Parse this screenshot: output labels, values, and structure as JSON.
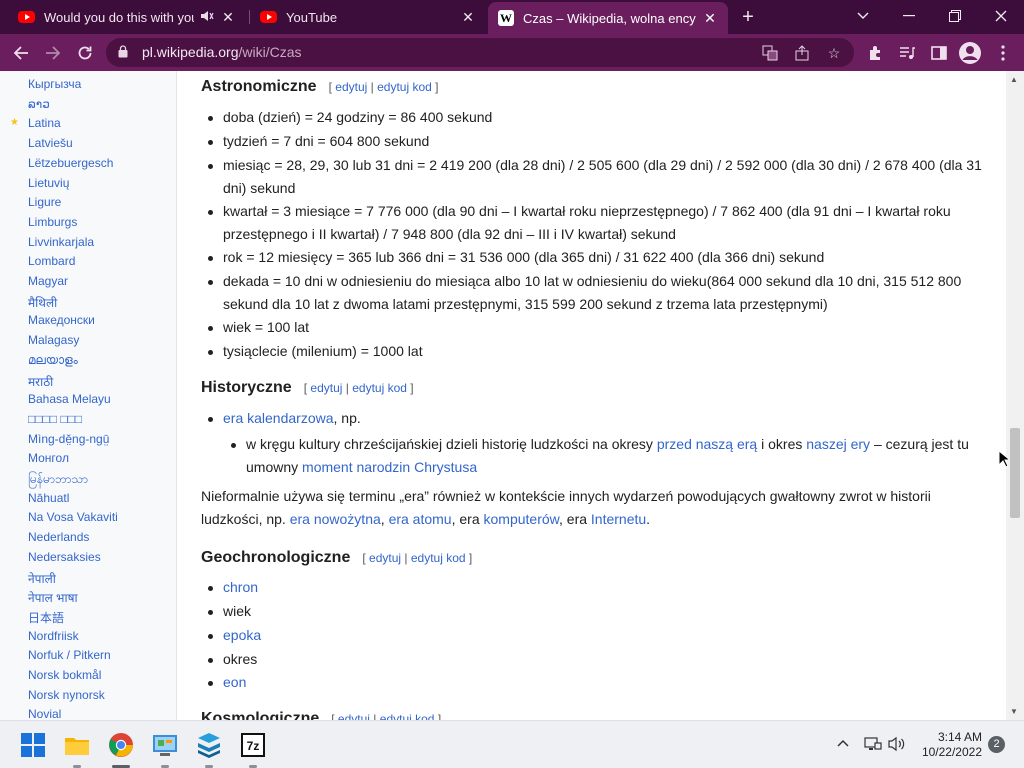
{
  "browser": {
    "tabs": [
      {
        "title": "Would you do this with your",
        "icon": "youtube-icon",
        "audio": true
      },
      {
        "title": "YouTube",
        "icon": "youtube-icon",
        "audio": false
      },
      {
        "title": "Czas – Wikipedia, wolna encyklop",
        "icon": "wikipedia-icon",
        "audio": false,
        "active": true
      }
    ],
    "new_tab_glyph": "+",
    "url_host": "pl.wikipedia.org",
    "url_path": "/wiki/Czas"
  },
  "sidebar": {
    "languages": [
      "Кыргызча",
      "ລາວ",
      "Latina",
      "Latviešu",
      "Lëtzebuergesch",
      "Lietuvių",
      "Ligure",
      "Limburgs",
      "Livvinkarjala",
      "Lombard",
      "Magyar",
      "मैथिली",
      "Македонски",
      "Malagasy",
      "മലയാളം",
      "मराठी",
      "Bahasa Melayu",
      "□□□□ □□□",
      "Mìng-dĕ̤ng-ngṳ̄",
      "Монгол",
      "မြန်မာဘာသာ",
      "Nāhuatl",
      "Na Vosa Vakaviti",
      "Nederlands",
      "Nedersaksies",
      "नेपाली",
      "नेपाल भाषा",
      "日本語",
      "Nordfriisk",
      "Norfuk / Pitkern",
      "Norsk bokmål",
      "Norsk nynorsk",
      "Novial"
    ],
    "featured_marker": "★",
    "featured_index": 2
  },
  "content": {
    "edit_links": {
      "open": "[",
      "edit": "edytuj",
      "sep": "|",
      "edit_code": "edytuj kod",
      "close": "]"
    },
    "sections": {
      "astro": {
        "heading": "Astronomiczne",
        "items": [
          "doba (dzień) = 24 godziny = 86 400 sekund",
          "tydzień = 7 dni = 604 800 sekund",
          "miesiąc = 28, 29, 30 lub 31 dni = 2 419 200 (dla 28 dni) / 2 505 600 (dla 29 dni) / 2 592 000 (dla 30 dni) / 2 678 400 (dla 31 dni) sekund",
          "kwartał = 3 miesiące = 7 776 000 (dla 90 dni – I kwartał roku nieprzestępnego) / 7 862 400 (dla 91 dni – I kwartał roku przestępnego i II kwartał) / 7 948 800 (dla 92 dni – III i IV kwartał) sekund",
          "rok = 12 miesięcy = 365 lub 366 dni = 31 536 000 (dla 365 dni) / 31 622 400 (dla 366 dni) sekund",
          "dekada = 10 dni w odniesieniu do miesiąca albo 10 lat w odniesieniu do wieku(864 000 sekund dla 10 dni, 315 512 800 sekund dla 10 lat z dwoma latami przestępnymi, 315 599 200 sekund z trzema lata przestępnymi)",
          "wiek = 100 lat",
          "tysiąclecie (milenium) = 1000 lat"
        ]
      },
      "hist": {
        "heading": "Historyczne",
        "item1_link": "era kalendarzowa",
        "item1_rest": ", np.",
        "sub_text1": "w kręgu kultury chrześcijańskiej dzieli historię ludzkości na okresy ",
        "sub_link1": "przed naszą erą",
        "sub_text2": " i okres ",
        "sub_link2": "naszej ery",
        "sub_text3": " – cezurą jest tu umowny ",
        "sub_link3": "moment narodzin Chrystusa",
        "para_text1": "Nieformalnie używa się terminu „era” również w kontekście innych wydarzeń powodujących gwałtowny zwrot w historii ludzkości, np. ",
        "para_link1": "era nowożytna",
        "para_text2": ", ",
        "para_link2": "era atomu",
        "para_text3": ", era ",
        "para_link3": "komputerów",
        "para_text4": ", era ",
        "para_link4": "Internetu",
        "para_text5": "."
      },
      "geo": {
        "heading": "Geochronologiczne",
        "items": [
          {
            "text": "chron",
            "link": true
          },
          {
            "text": "wiek",
            "link": false
          },
          {
            "text": "epoka",
            "link": true
          },
          {
            "text": "okres",
            "link": false
          },
          {
            "text": "eon",
            "link": true
          }
        ]
      },
      "kosmo": {
        "heading": "Kosmologiczne"
      }
    }
  },
  "taskbar": {
    "time": "3:14 AM",
    "date": "10/22/2022",
    "notifications": "2",
    "apps": [
      "windows-start",
      "file-explorer",
      "chrome",
      "control-panel",
      "app-stack",
      "7zip"
    ]
  },
  "colors": {
    "tab_strip": "#3c0d3a",
    "toolbar": "#6a1e5d",
    "link": "#3366cc",
    "text": "#202122"
  }
}
